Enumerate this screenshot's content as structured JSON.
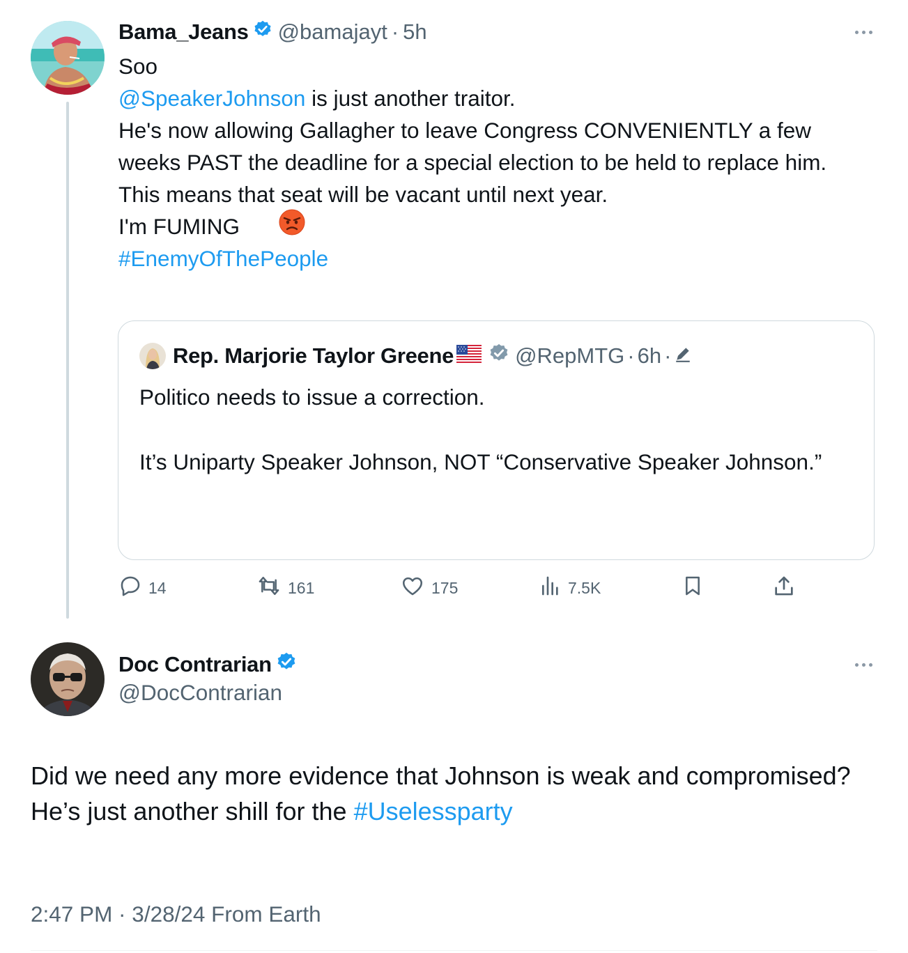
{
  "tweet": {
    "author_name": "Bama_Jeans",
    "handle": "@bamajayt",
    "separator": "·",
    "time": "5h",
    "lines": {
      "l1": "Soo",
      "mention": "@SpeakerJohnson",
      "l2_rest": " is just another traitor.",
      "l3": "He's now allowing Gallagher to leave Congress CONVENIENTLY a few weeks PAST the deadline for a special election to be held to replace him.",
      "l4": "This means that seat will be vacant until next year.",
      "l5": "I'm FUMING",
      "hashtag": "#EnemyOfThePeople"
    }
  },
  "quoted": {
    "author_name": "Rep. Marjorie Taylor Greene",
    "handle": "@RepMTG",
    "separator": "·",
    "time": "6h",
    "separator2": "·",
    "p1": "Politico needs to issue a correction.",
    "p2": "It’s Uniparty Speaker Johnson, NOT “Conservative Speaker Johnson.”"
  },
  "actions": {
    "replies": "14",
    "reposts": "161",
    "likes": "175",
    "views": "7.5K"
  },
  "reply": {
    "author_name": "Doc Contrarian",
    "handle": "@DocContrarian",
    "line1": "Did we need any more evidence that Johnson is weak and compromised?",
    "line2_prefix": "He’s just another shill for the ",
    "hashtag": "#Uselessparty",
    "meta": "2:47 PM · 3/28/24 From Earth"
  },
  "colors": {
    "accent": "#1d9bf0",
    "muted": "#536471",
    "border": "#cfd9de"
  },
  "icons": [
    "verified-badge-icon",
    "more-icon",
    "reply-icon",
    "repost-icon",
    "like-icon",
    "views-icon",
    "bookmark-icon",
    "share-icon",
    "us-flag-icon",
    "edit-icon",
    "angry-face-icon"
  ]
}
